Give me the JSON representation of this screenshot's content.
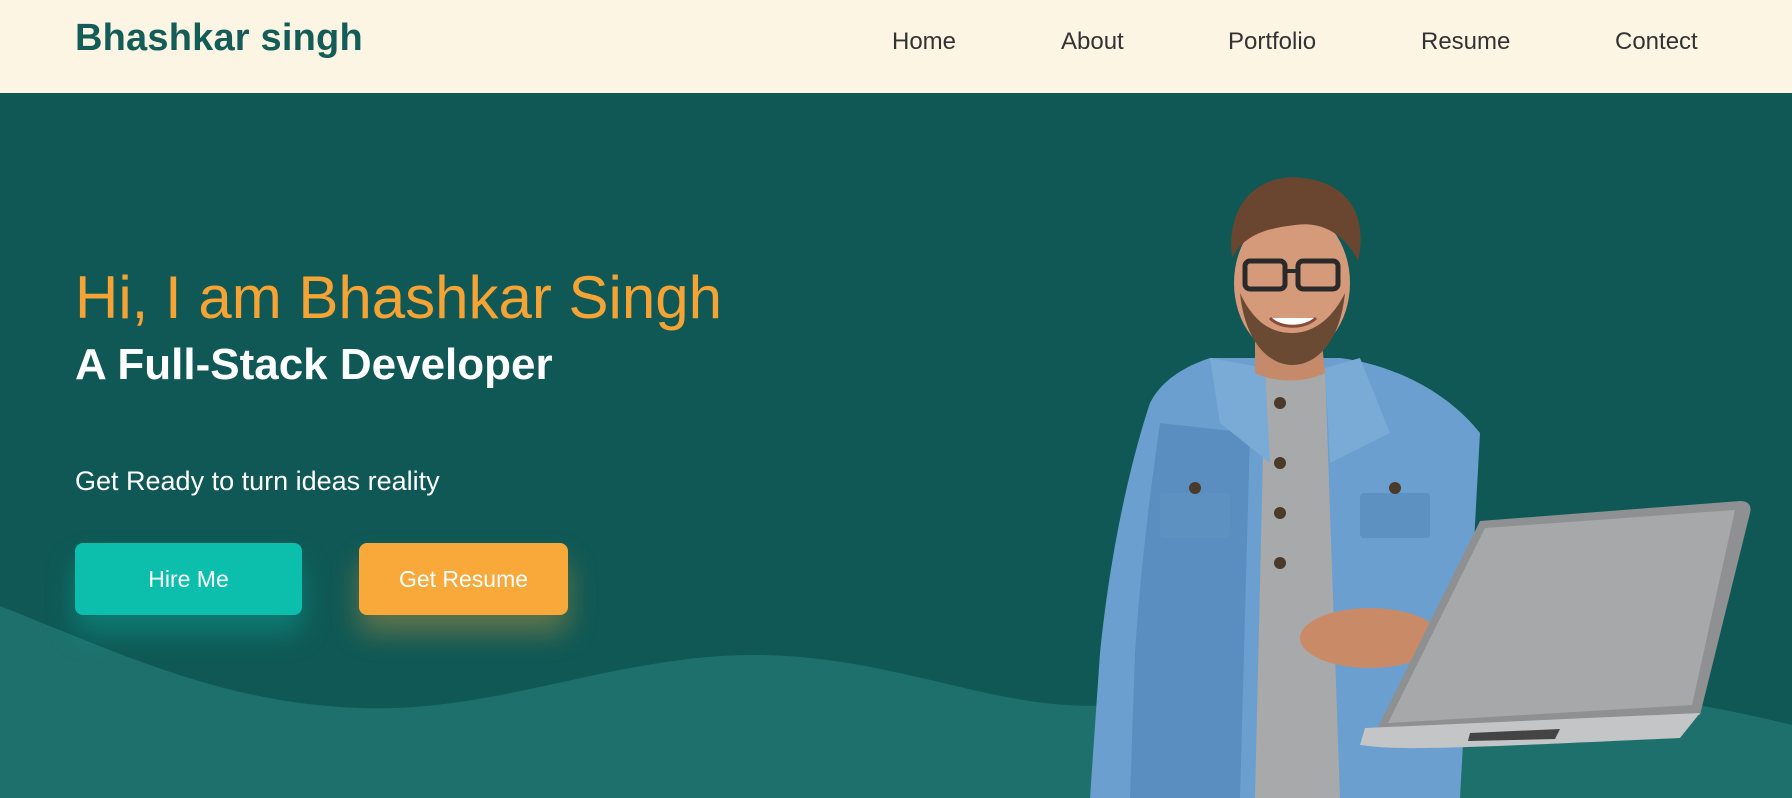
{
  "brand": {
    "name": "Bhashkar singh"
  },
  "nav": {
    "items": [
      {
        "label": "Home"
      },
      {
        "label": "About"
      },
      {
        "label": "Portfolio"
      },
      {
        "label": "Resume"
      },
      {
        "label": "Contect"
      }
    ]
  },
  "hero": {
    "greeting": "Hi, I am Bhashkar Singh",
    "role": "A Full-Stack Developer",
    "tagline": "Get Ready to turn ideas reality",
    "hire_label": "Hire Me",
    "resume_label": "Get Resume"
  },
  "colors": {
    "nav_bg": "#fdf5e3",
    "brand": "#135c58",
    "hero_bg": "#0f5855",
    "wave": "#1e706c",
    "accent_orange": "#f5a334",
    "accent_teal": "#0cbfad"
  },
  "image": {
    "icon": "developer-with-laptop-photo"
  }
}
